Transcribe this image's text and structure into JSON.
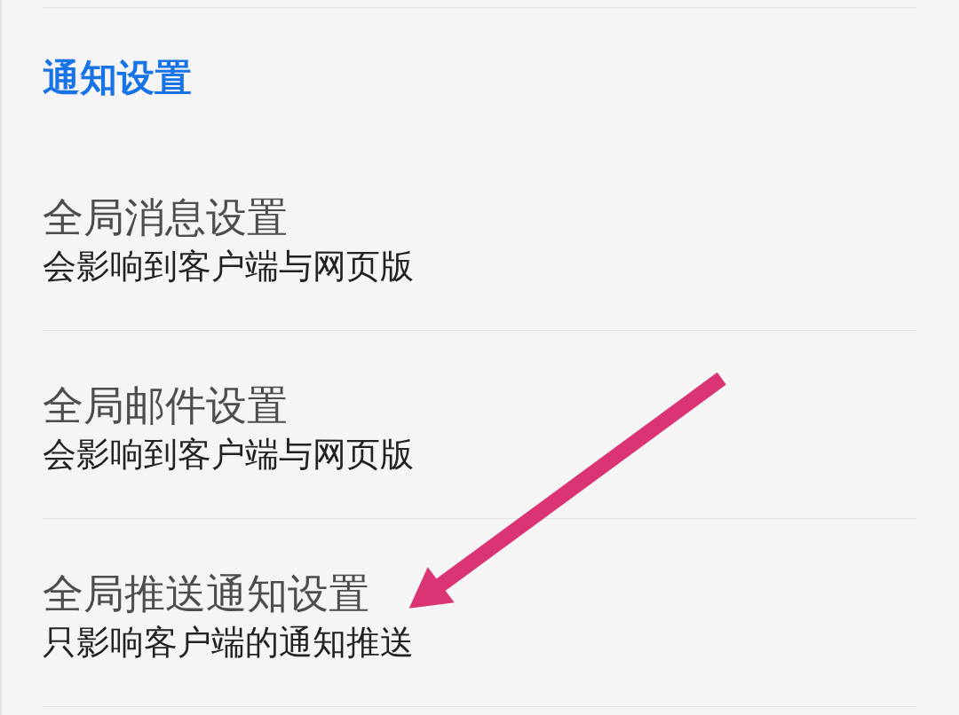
{
  "section": {
    "title": "通知设置"
  },
  "items": [
    {
      "title": "全局消息设置",
      "description": "会影响到客户端与网页版"
    },
    {
      "title": "全局邮件设置",
      "description": "会影响到客户端与网页版"
    },
    {
      "title": "全局推送通知设置",
      "description": "只影响客户端的通知推送"
    }
  ]
}
